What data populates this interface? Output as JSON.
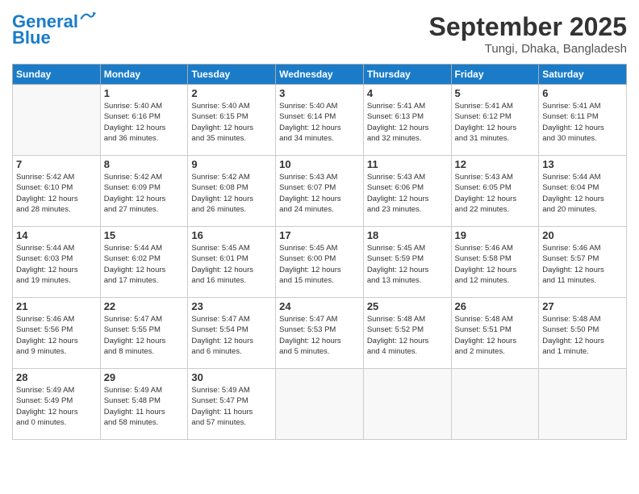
{
  "logo": {
    "line1": "General",
    "line2": "Blue"
  },
  "title": "September 2025",
  "location": "Tungi, Dhaka, Bangladesh",
  "header_days": [
    "Sunday",
    "Monday",
    "Tuesday",
    "Wednesday",
    "Thursday",
    "Friday",
    "Saturday"
  ],
  "weeks": [
    [
      {
        "day": "",
        "text": ""
      },
      {
        "day": "1",
        "text": "Sunrise: 5:40 AM\nSunset: 6:16 PM\nDaylight: 12 hours\nand 36 minutes."
      },
      {
        "day": "2",
        "text": "Sunrise: 5:40 AM\nSunset: 6:15 PM\nDaylight: 12 hours\nand 35 minutes."
      },
      {
        "day": "3",
        "text": "Sunrise: 5:40 AM\nSunset: 6:14 PM\nDaylight: 12 hours\nand 34 minutes."
      },
      {
        "day": "4",
        "text": "Sunrise: 5:41 AM\nSunset: 6:13 PM\nDaylight: 12 hours\nand 32 minutes."
      },
      {
        "day": "5",
        "text": "Sunrise: 5:41 AM\nSunset: 6:12 PM\nDaylight: 12 hours\nand 31 minutes."
      },
      {
        "day": "6",
        "text": "Sunrise: 5:41 AM\nSunset: 6:11 PM\nDaylight: 12 hours\nand 30 minutes."
      }
    ],
    [
      {
        "day": "7",
        "text": "Sunrise: 5:42 AM\nSunset: 6:10 PM\nDaylight: 12 hours\nand 28 minutes."
      },
      {
        "day": "8",
        "text": "Sunrise: 5:42 AM\nSunset: 6:09 PM\nDaylight: 12 hours\nand 27 minutes."
      },
      {
        "day": "9",
        "text": "Sunrise: 5:42 AM\nSunset: 6:08 PM\nDaylight: 12 hours\nand 26 minutes."
      },
      {
        "day": "10",
        "text": "Sunrise: 5:43 AM\nSunset: 6:07 PM\nDaylight: 12 hours\nand 24 minutes."
      },
      {
        "day": "11",
        "text": "Sunrise: 5:43 AM\nSunset: 6:06 PM\nDaylight: 12 hours\nand 23 minutes."
      },
      {
        "day": "12",
        "text": "Sunrise: 5:43 AM\nSunset: 6:05 PM\nDaylight: 12 hours\nand 22 minutes."
      },
      {
        "day": "13",
        "text": "Sunrise: 5:44 AM\nSunset: 6:04 PM\nDaylight: 12 hours\nand 20 minutes."
      }
    ],
    [
      {
        "day": "14",
        "text": "Sunrise: 5:44 AM\nSunset: 6:03 PM\nDaylight: 12 hours\nand 19 minutes."
      },
      {
        "day": "15",
        "text": "Sunrise: 5:44 AM\nSunset: 6:02 PM\nDaylight: 12 hours\nand 17 minutes."
      },
      {
        "day": "16",
        "text": "Sunrise: 5:45 AM\nSunset: 6:01 PM\nDaylight: 12 hours\nand 16 minutes."
      },
      {
        "day": "17",
        "text": "Sunrise: 5:45 AM\nSunset: 6:00 PM\nDaylight: 12 hours\nand 15 minutes."
      },
      {
        "day": "18",
        "text": "Sunrise: 5:45 AM\nSunset: 5:59 PM\nDaylight: 12 hours\nand 13 minutes."
      },
      {
        "day": "19",
        "text": "Sunrise: 5:46 AM\nSunset: 5:58 PM\nDaylight: 12 hours\nand 12 minutes."
      },
      {
        "day": "20",
        "text": "Sunrise: 5:46 AM\nSunset: 5:57 PM\nDaylight: 12 hours\nand 11 minutes."
      }
    ],
    [
      {
        "day": "21",
        "text": "Sunrise: 5:46 AM\nSunset: 5:56 PM\nDaylight: 12 hours\nand 9 minutes."
      },
      {
        "day": "22",
        "text": "Sunrise: 5:47 AM\nSunset: 5:55 PM\nDaylight: 12 hours\nand 8 minutes."
      },
      {
        "day": "23",
        "text": "Sunrise: 5:47 AM\nSunset: 5:54 PM\nDaylight: 12 hours\nand 6 minutes."
      },
      {
        "day": "24",
        "text": "Sunrise: 5:47 AM\nSunset: 5:53 PM\nDaylight: 12 hours\nand 5 minutes."
      },
      {
        "day": "25",
        "text": "Sunrise: 5:48 AM\nSunset: 5:52 PM\nDaylight: 12 hours\nand 4 minutes."
      },
      {
        "day": "26",
        "text": "Sunrise: 5:48 AM\nSunset: 5:51 PM\nDaylight: 12 hours\nand 2 minutes."
      },
      {
        "day": "27",
        "text": "Sunrise: 5:48 AM\nSunset: 5:50 PM\nDaylight: 12 hours\nand 1 minute."
      }
    ],
    [
      {
        "day": "28",
        "text": "Sunrise: 5:49 AM\nSunset: 5:49 PM\nDaylight: 12 hours\nand 0 minutes."
      },
      {
        "day": "29",
        "text": "Sunrise: 5:49 AM\nSunset: 5:48 PM\nDaylight: 11 hours\nand 58 minutes."
      },
      {
        "day": "30",
        "text": "Sunrise: 5:49 AM\nSunset: 5:47 PM\nDaylight: 11 hours\nand 57 minutes."
      },
      {
        "day": "",
        "text": ""
      },
      {
        "day": "",
        "text": ""
      },
      {
        "day": "",
        "text": ""
      },
      {
        "day": "",
        "text": ""
      }
    ]
  ]
}
